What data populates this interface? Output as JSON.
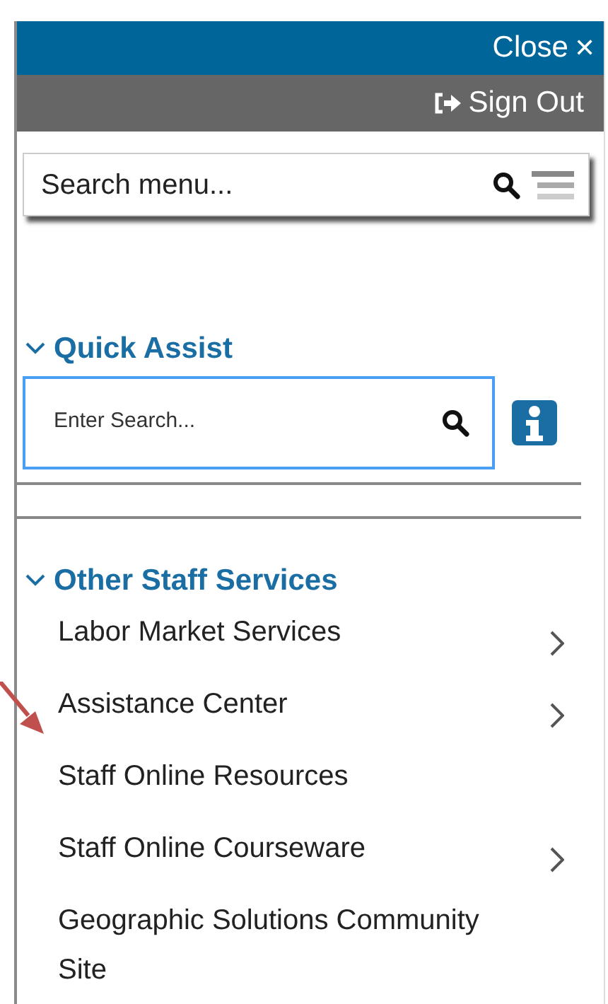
{
  "header": {
    "close_label": "Close",
    "close_glyph": "✕",
    "sign_out_label": "Sign Out"
  },
  "menu_search": {
    "placeholder": "Search menu..."
  },
  "sections": [
    {
      "title": "Quick Assist",
      "expanded": true,
      "kind": "search",
      "placeholder": "Enter Search..."
    },
    {
      "title": "Other Staff Services",
      "expanded": true,
      "kind": "links",
      "items": [
        {
          "label": "Labor Market Services",
          "has_submenu": true
        },
        {
          "label": "Assistance Center",
          "has_submenu": true
        },
        {
          "label": "Staff Online Resources",
          "has_submenu": false
        },
        {
          "label": "Staff Online Courseware",
          "has_submenu": true
        },
        {
          "label": "Geographic Solutions Community Site",
          "has_submenu": false
        }
      ]
    }
  ]
}
